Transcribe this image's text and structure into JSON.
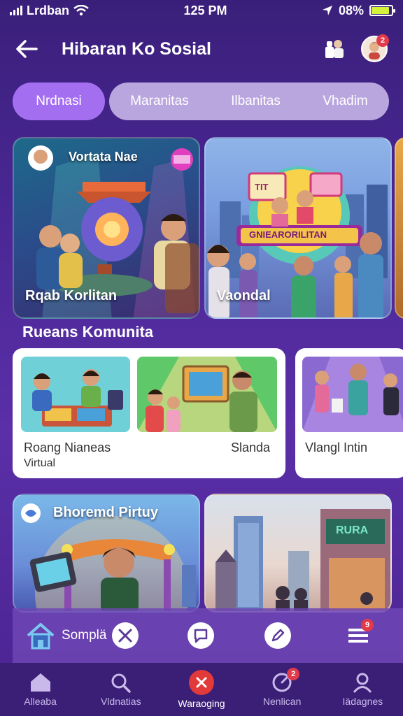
{
  "status": {
    "carrier": "Lrdban",
    "time": "125 PM",
    "battery": "08%"
  },
  "header": {
    "title": "Hibaran Ko Sosial",
    "notif_count": "2"
  },
  "tabs": {
    "active": "Nrdnasi",
    "items": [
      "Maranitas",
      "Ilbanitas",
      "Vhadim"
    ]
  },
  "featured": [
    {
      "top_label": "Vortata Nae",
      "label": "Rqab Korlitan"
    },
    {
      "banner_top": "TIT",
      "banner_main": "GNIEARORILITAN",
      "label": "Vaondal"
    }
  ],
  "section": {
    "title": "Rueans Komunita"
  },
  "community": [
    {
      "caption_left": "Roang Nianeas",
      "caption_left2": "Virtual",
      "caption_right": "Slanda"
    },
    {
      "caption": "Vlangl Intin"
    }
  ],
  "lower": [
    {
      "label": "Bhoremd Pirtuy"
    },
    {
      "sign": "RURA"
    }
  ],
  "floatbar": {
    "label": "Somplä",
    "badge": "9"
  },
  "bottom_nav": [
    {
      "label": "Alleaba"
    },
    {
      "label": "Vldnatias"
    },
    {
      "label": "Waraoging"
    },
    {
      "label": "Nenlican",
      "badge": "2"
    },
    {
      "label": "Iädagnes"
    }
  ],
  "colors": {
    "accent": "#a46ef0",
    "background": "#4a2794",
    "badge": "#e23a4a"
  }
}
